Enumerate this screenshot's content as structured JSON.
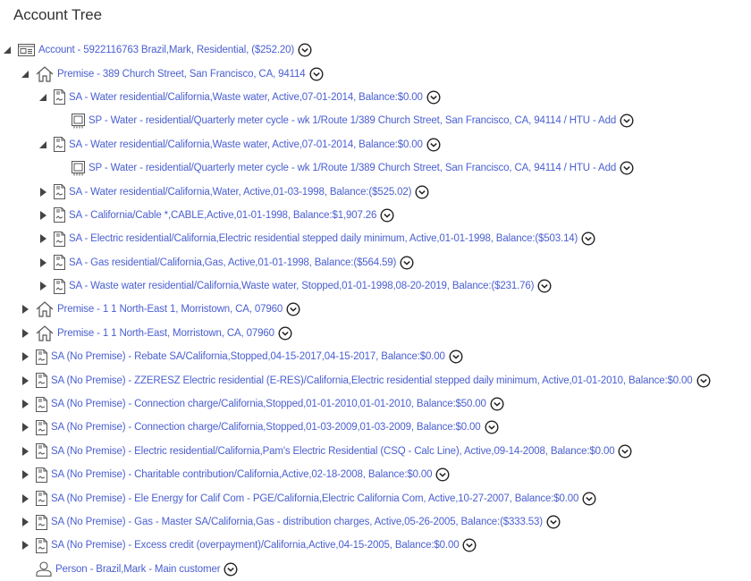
{
  "page": {
    "title": "Account Tree"
  },
  "colors": {
    "link": "#4a5fd0",
    "icon": "#555555",
    "title": "#333333"
  },
  "tree": [
    {
      "level": 0,
      "state": "expanded",
      "icon": "account-card-icon",
      "label": "Account - 5922116763 Brazil,Mark, Residential, ($252.20)"
    },
    {
      "level": 1,
      "state": "expanded",
      "icon": "house-icon",
      "label": "Premise - 389 Church Street, San Francisco, CA, 94114"
    },
    {
      "level": 2,
      "state": "expanded",
      "icon": "document-icon",
      "label": "SA - Water residential/California,Waste water, Active,07-01-2014, Balance:$0.00"
    },
    {
      "level": 3,
      "state": "leaf",
      "icon": "meter-icon",
      "label": "SP - Water - residential/Quarterly meter cycle - wk 1/Route 1/389 Church Street, San Francisco, CA, 94114 / HTU - Add"
    },
    {
      "level": 2,
      "state": "expanded",
      "icon": "document-icon",
      "label": "SA - Water residential/California,Waste water, Active,07-01-2014, Balance:$0.00"
    },
    {
      "level": 3,
      "state": "leaf",
      "icon": "meter-icon",
      "label": "SP - Water - residential/Quarterly meter cycle - wk 1/Route 1/389 Church Street, San Francisco, CA, 94114 / HTU - Add"
    },
    {
      "level": 2,
      "state": "collapsed",
      "icon": "document-icon",
      "label": "SA - Water residential/California,Water, Active,01-03-1998, Balance:($525.02)"
    },
    {
      "level": 2,
      "state": "collapsed",
      "icon": "document-icon",
      "label": "SA - California/Cable *,CABLE,Active,01-01-1998, Balance:$1,907.26"
    },
    {
      "level": 2,
      "state": "collapsed",
      "icon": "document-icon",
      "label": "SA - Electric residential/California,Electric residential stepped daily minimum, Active,01-01-1998, Balance:($503.14)"
    },
    {
      "level": 2,
      "state": "collapsed",
      "icon": "document-icon",
      "label": "SA - Gas residential/California,Gas, Active,01-01-1998, Balance:($564.59)"
    },
    {
      "level": 2,
      "state": "collapsed",
      "icon": "document-icon",
      "label": "SA - Waste water residential/California,Waste water, Stopped,01-01-1998,08-20-2019, Balance:($231.76)"
    },
    {
      "level": 1,
      "state": "collapsed",
      "icon": "house-icon",
      "label": "Premise - 1 1 North-East 1, Morristown, CA, 07960"
    },
    {
      "level": 1,
      "state": "collapsed",
      "icon": "house-icon",
      "label": "Premise - 1 1 North-East, Morristown, CA, 07960"
    },
    {
      "level": 1,
      "state": "collapsed",
      "icon": "document-icon",
      "label": "SA (No Premise) - Rebate SA/California,Stopped,04-15-2017,04-15-2017, Balance:$0.00"
    },
    {
      "level": 1,
      "state": "collapsed",
      "icon": "document-icon",
      "label": "SA (No Premise) - ZZERESZ Electric residential (E-RES)/California,Electric residential stepped daily minimum, Active,01-01-2010, Balance:$0.00"
    },
    {
      "level": 1,
      "state": "collapsed",
      "icon": "document-icon",
      "label": "SA (No Premise) - Connection charge/California,Stopped,01-01-2010,01-01-2010, Balance:$50.00"
    },
    {
      "level": 1,
      "state": "collapsed",
      "icon": "document-icon",
      "label": "SA (No Premise) - Connection charge/California,Stopped,01-03-2009,01-03-2009, Balance:$0.00"
    },
    {
      "level": 1,
      "state": "collapsed",
      "icon": "document-icon",
      "label": "SA (No Premise) - Electric residential/California,Pam's Electric Residential (CSQ - Calc Line), Active,09-14-2008, Balance:$0.00"
    },
    {
      "level": 1,
      "state": "collapsed",
      "icon": "document-icon",
      "label": "SA (No Premise) - Charitable contribution/California,Active,02-18-2008, Balance:$0.00"
    },
    {
      "level": 1,
      "state": "collapsed",
      "icon": "document-icon",
      "label": "SA (No Premise) - Ele Energy for Calif Com - PGE/California,Electric California Com, Active,10-27-2007, Balance:$0.00"
    },
    {
      "level": 1,
      "state": "collapsed",
      "icon": "document-icon",
      "label": "SA (No Premise) - Gas - Master SA/California,Gas - distribution charges, Active,05-26-2005, Balance:($333.53)"
    },
    {
      "level": 1,
      "state": "collapsed",
      "icon": "document-icon",
      "label": "SA (No Premise) - Excess credit (overpayment)/California,Active,04-15-2005, Balance:$0.00"
    },
    {
      "level": 1,
      "state": "leaf",
      "icon": "person-icon",
      "label": "Person - Brazil,Mark - Main customer"
    }
  ]
}
